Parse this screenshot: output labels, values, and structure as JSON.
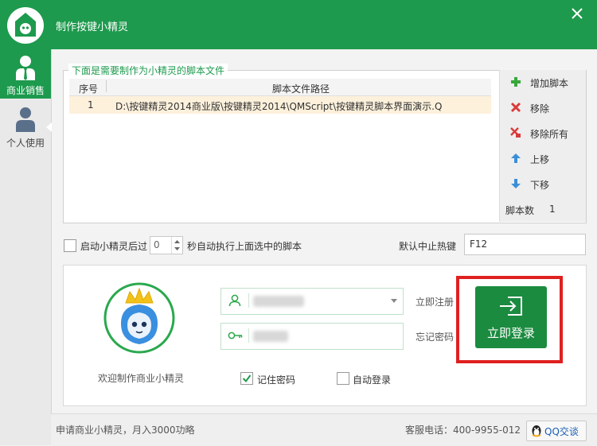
{
  "window": {
    "title": "制作按键小精灵"
  },
  "sidebar": {
    "items": [
      {
        "label": "商业销售"
      },
      {
        "label": "个人使用"
      }
    ]
  },
  "script_list": {
    "legend": "下面是需要制作为小精灵的脚本文件",
    "columns": [
      "序号",
      "脚本文件路径"
    ],
    "rows": [
      {
        "index": "1",
        "path": "D:\\按键精灵2014商业版\\按键精灵2014\\QMScript\\按键精灵脚本界面演示.Q"
      }
    ]
  },
  "actions": {
    "add": "增加脚本",
    "remove": "移除",
    "remove_all": "移除所有",
    "up": "上移",
    "down": "下移",
    "count_label": "脚本数",
    "count_value": "1"
  },
  "autorun": {
    "prefix": "启动小精灵后过",
    "seconds": "0",
    "suffix": "秒自动执行上面选中的脚本"
  },
  "hotkey": {
    "label": "默认中止热键",
    "value": "F12"
  },
  "login": {
    "welcome": "欢迎制作商业小精灵",
    "register": "立即注册",
    "forgot": "忘记密码",
    "remember": "记住密码",
    "auto_login": "自动登录",
    "button": "立即登录"
  },
  "footer": {
    "left": "申请商业小精灵，月入3000功略",
    "phone": "客服电话：400-9955-012",
    "qq": "QQ交谈"
  },
  "colors": {
    "brand_green": "#1d9a4d",
    "highlight_red": "#e02020"
  }
}
